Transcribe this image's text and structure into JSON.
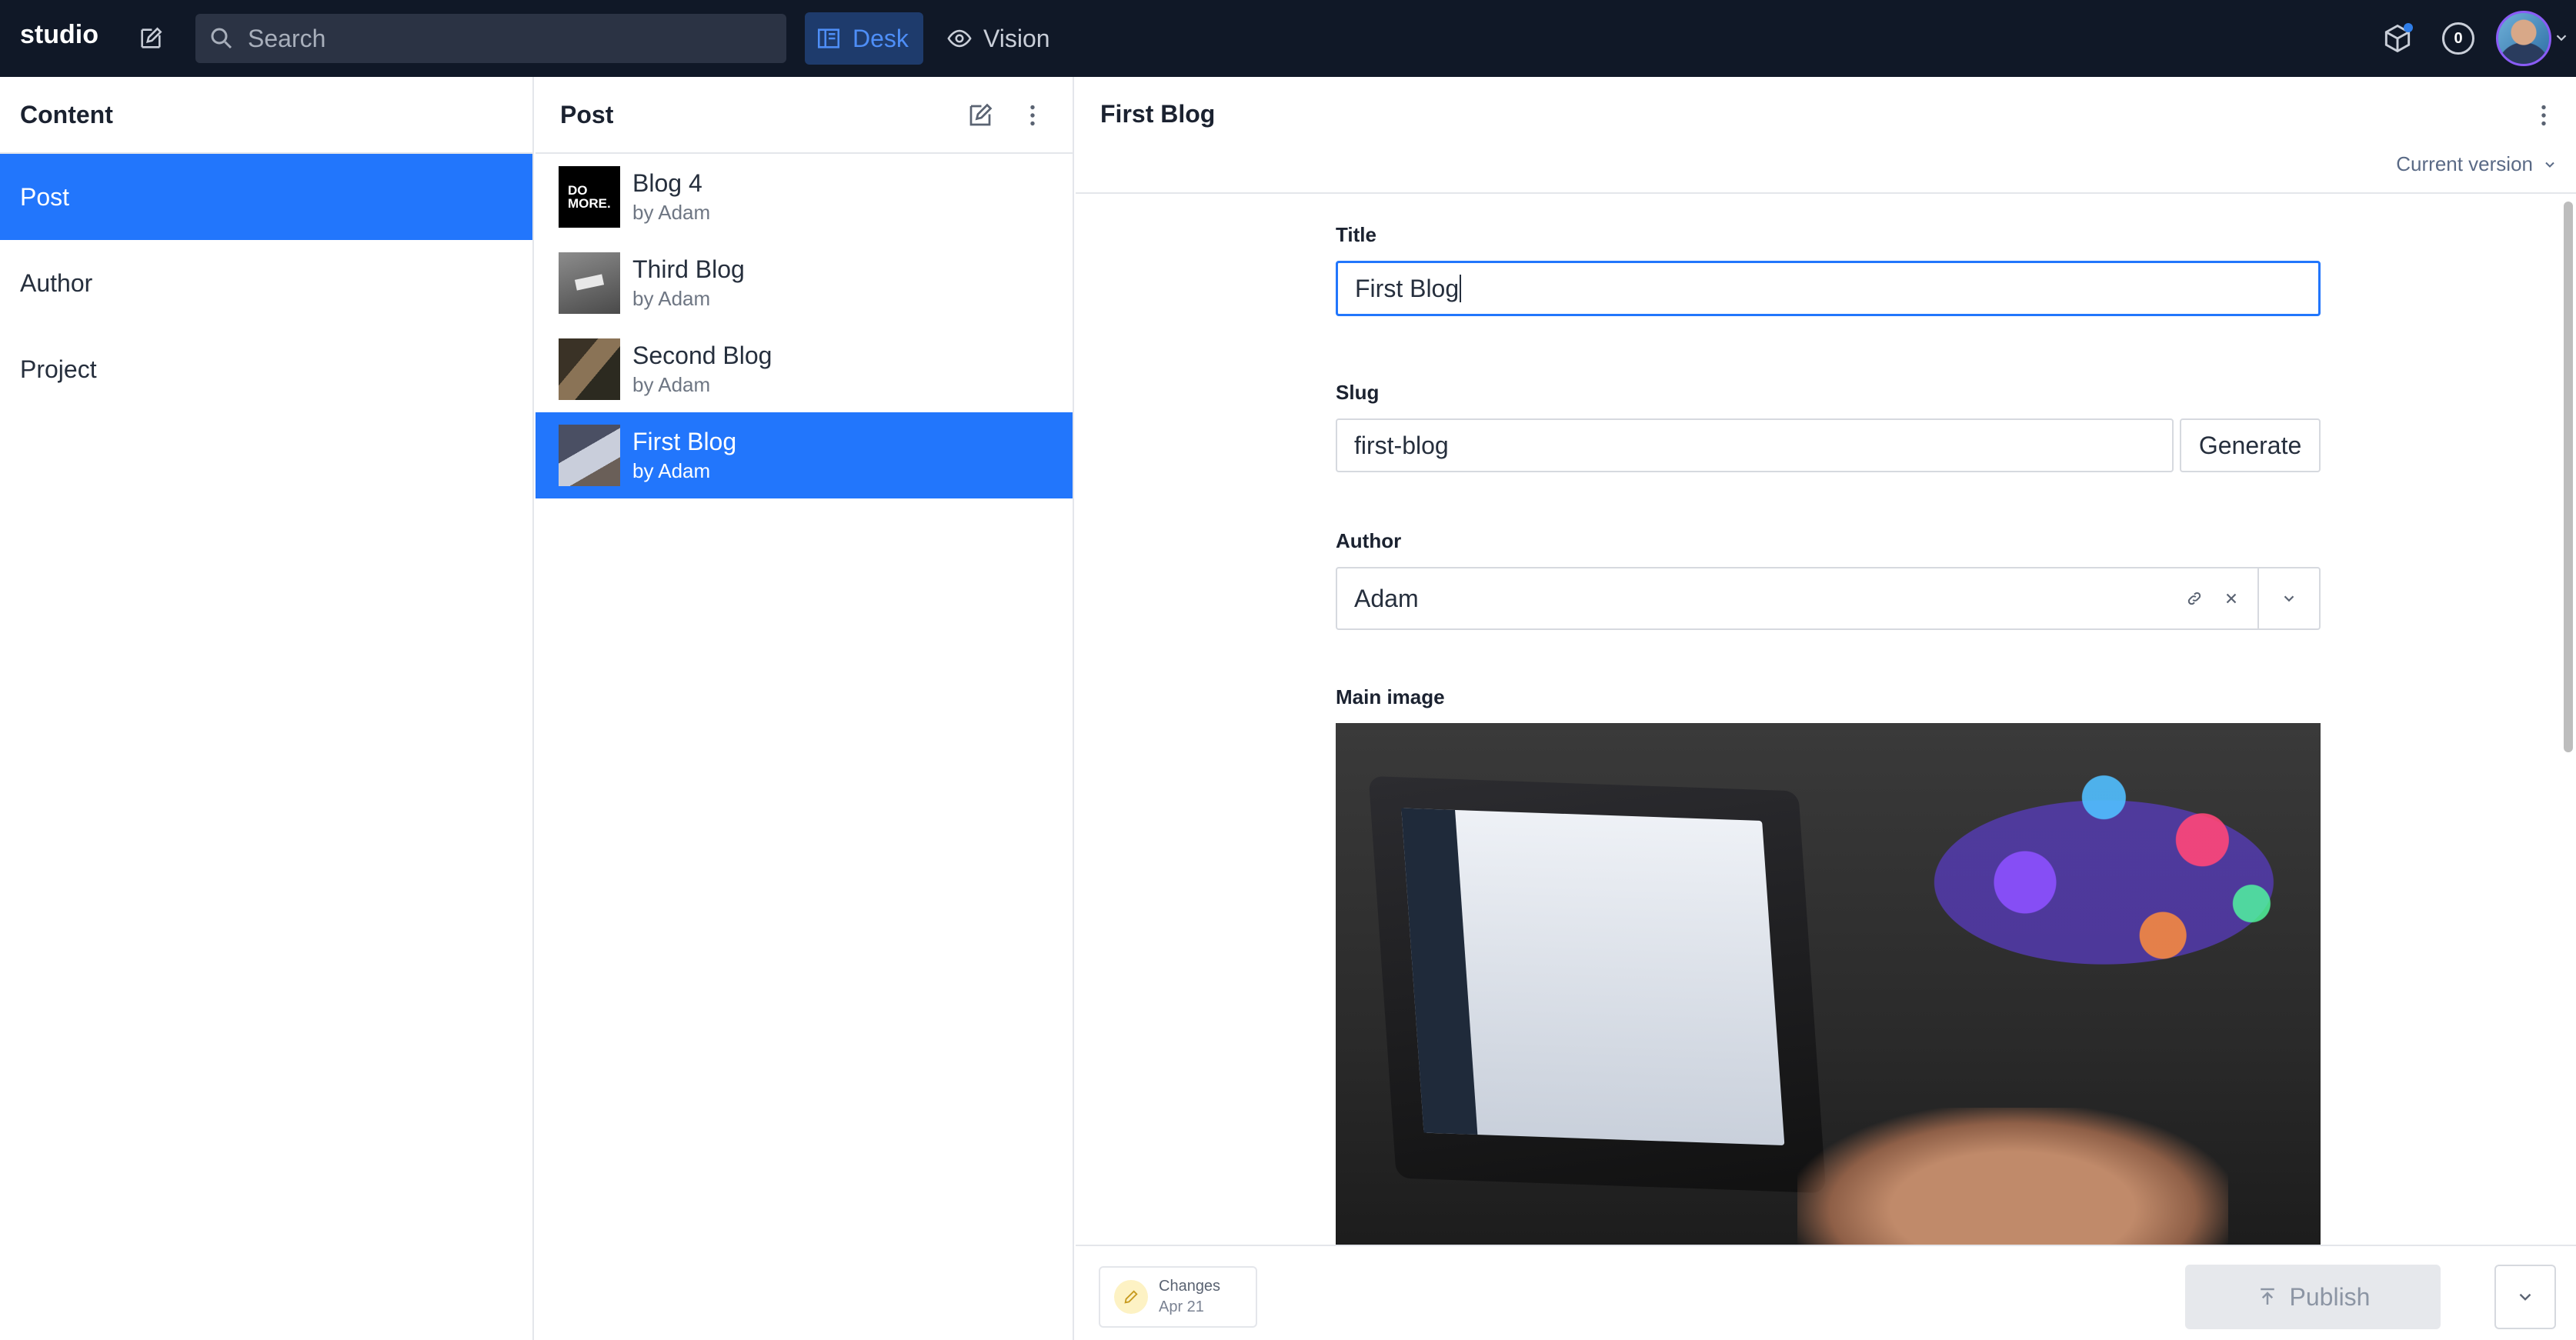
{
  "app": {
    "brand": "studio"
  },
  "topbar": {
    "search_placeholder": "Search",
    "tools": [
      {
        "label": "Desk",
        "active": true
      },
      {
        "label": "Vision",
        "active": false
      }
    ],
    "counter": "0",
    "accent": "#2276fc"
  },
  "content_pane": {
    "title": "Content",
    "items": [
      {
        "label": "Post",
        "active": true
      },
      {
        "label": "Author",
        "active": false
      },
      {
        "label": "Project",
        "active": false
      }
    ]
  },
  "post_pane": {
    "title": "Post",
    "documents": [
      {
        "title": "Blog 4",
        "subtitle": "by Adam",
        "thumb_text": [
          "DO",
          "MORE."
        ],
        "active": false
      },
      {
        "title": "Third Blog",
        "subtitle": "by Adam",
        "active": false
      },
      {
        "title": "Second Blog",
        "subtitle": "by Adam",
        "active": false
      },
      {
        "title": "First Blog",
        "subtitle": "by Adam",
        "active": true
      }
    ]
  },
  "document": {
    "title": "First Blog",
    "version_label": "Current version",
    "fields": {
      "title_label": "Title",
      "title_value": "First Blog",
      "slug_label": "Slug",
      "slug_value": "first-blog",
      "generate_label": "Generate",
      "author_label": "Author",
      "author_value": "Adam",
      "main_image_label": "Main image"
    }
  },
  "footer": {
    "changes_label": "Changes",
    "changes_date": "Apr 21",
    "publish_label": "Publish"
  }
}
